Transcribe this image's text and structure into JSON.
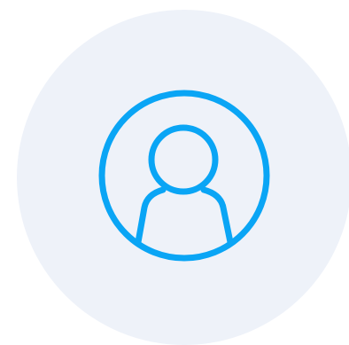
{
  "avatar": {
    "icon": "user-avatar-icon",
    "colors": {
      "background": "#ffffff",
      "backdrop": "#eef2f9",
      "stroke": "#0aa5f5"
    }
  }
}
